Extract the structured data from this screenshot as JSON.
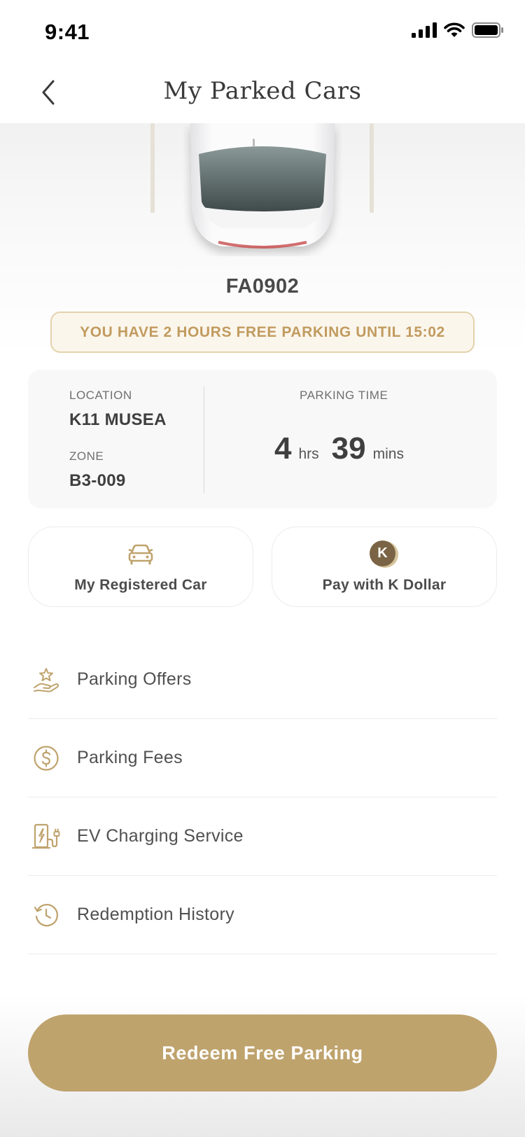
{
  "status_bar": {
    "time": "9:41"
  },
  "header": {
    "title": "My Parked Cars"
  },
  "car": {
    "plate": "FA0902"
  },
  "free_parking_banner": "YOU HAVE 2 HOURS FREE PARKING UNTIL 15:02",
  "info": {
    "location_label": "LOCATION",
    "location_value": "K11 MUSEA",
    "zone_label": "ZONE",
    "zone_value": "B3-009",
    "parking_time_label": "PARKING TIME",
    "hours": "4",
    "hours_unit": "hrs",
    "minutes": "39",
    "minutes_unit": "mins"
  },
  "actions": {
    "registered_car": "My Registered Car",
    "k_dollar_icon_letter": "K",
    "k_dollar": "Pay with K Dollar"
  },
  "menu": [
    {
      "label": "Parking Offers",
      "icon": "hand-star-icon"
    },
    {
      "label": "Parking Fees",
      "icon": "dollar-circle-icon"
    },
    {
      "label": "EV Charging Service",
      "icon": "ev-charger-icon"
    },
    {
      "label": "Redemption History",
      "icon": "history-icon"
    }
  ],
  "redeem_button": "Redeem Free Parking",
  "colors": {
    "accent": "#bfa36d",
    "banner_text": "#c19b5f",
    "banner_border": "#e3d2ad"
  }
}
